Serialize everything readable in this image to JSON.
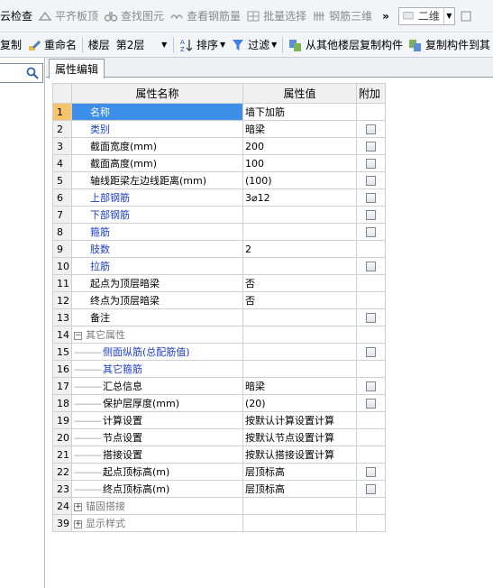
{
  "toolbar_top": {
    "cloud_check": "云检查",
    "align_slab": "平齐板顶",
    "find_element": "查找图元",
    "view_rebar": "查看钢筋量",
    "batch_select": "批量选择",
    "rebar_3d": "钢筋三维",
    "overflow": "»",
    "view_mode": "二维"
  },
  "toolbar_second": {
    "copy": "复制",
    "rename": "重命名",
    "floor_label": "楼层",
    "floor_value": "第2层",
    "sort": "排序",
    "filter": "过滤",
    "copy_from_floor": "从其他楼层复制构件",
    "copy_to_floor": "复制构件到其"
  },
  "tab": {
    "label": "属性编辑"
  },
  "grid": {
    "headers": {
      "name": "属性名称",
      "value": "属性值",
      "extra": "附加"
    },
    "rows": [
      {
        "num": "1",
        "name": "名称",
        "value": "墙下加筋",
        "check": false
      },
      {
        "num": "2",
        "name": "类别",
        "value": "暗梁",
        "check": true
      },
      {
        "num": "3",
        "name": "截面宽度(mm)",
        "value": "200",
        "check": true
      },
      {
        "num": "4",
        "name": "截面高度(mm)",
        "value": "100",
        "check": true
      },
      {
        "num": "5",
        "name": "轴线距梁左边线距离(mm)",
        "value": "(100)",
        "check": true
      },
      {
        "num": "6",
        "name": "上部钢筋",
        "value": "3⌀12",
        "check": true
      },
      {
        "num": "7",
        "name": "下部钢筋",
        "value": "",
        "check": true
      },
      {
        "num": "8",
        "name": "箍筋",
        "value": "",
        "check": true
      },
      {
        "num": "9",
        "name": "肢数",
        "value": "2",
        "check": false
      },
      {
        "num": "10",
        "name": "拉筋",
        "value": "",
        "check": true
      },
      {
        "num": "11",
        "name": "起点为顶层暗梁",
        "value": "否",
        "check": false
      },
      {
        "num": "12",
        "name": "终点为顶层暗梁",
        "value": "否",
        "check": false
      },
      {
        "num": "13",
        "name": "备注",
        "value": "",
        "check": true
      },
      {
        "num": "14",
        "name": "其它属性",
        "value": "",
        "check": false
      },
      {
        "num": "15",
        "name": "侧面纵筋(总配筋值)",
        "value": "",
        "check": true
      },
      {
        "num": "16",
        "name": "其它箍筋",
        "value": "",
        "check": false
      },
      {
        "num": "17",
        "name": "汇总信息",
        "value": "暗梁",
        "check": true
      },
      {
        "num": "18",
        "name": "保护层厚度(mm)",
        "value": "(20)",
        "check": true
      },
      {
        "num": "19",
        "name": "计算设置",
        "value": "按默认计算设置计算",
        "check": false
      },
      {
        "num": "20",
        "name": "节点设置",
        "value": "按默认节点设置计算",
        "check": false
      },
      {
        "num": "21",
        "name": "搭接设置",
        "value": "按默认搭接设置计算",
        "check": false
      },
      {
        "num": "22",
        "name": "起点顶标高(m)",
        "value": "层顶标高",
        "check": true
      },
      {
        "num": "23",
        "name": "终点顶标高(m)",
        "value": "层顶标高",
        "check": true
      },
      {
        "num": "24",
        "name": "锚固搭接",
        "value": "",
        "check": false
      },
      {
        "num": "39",
        "name": "显示样式",
        "value": "",
        "check": false
      }
    ]
  },
  "colors": {
    "selected_row": "#3d8ee8",
    "header_value": "#f6c46a",
    "blue_label": "#1f3fc4",
    "grey_label": "#7a7a7a"
  }
}
